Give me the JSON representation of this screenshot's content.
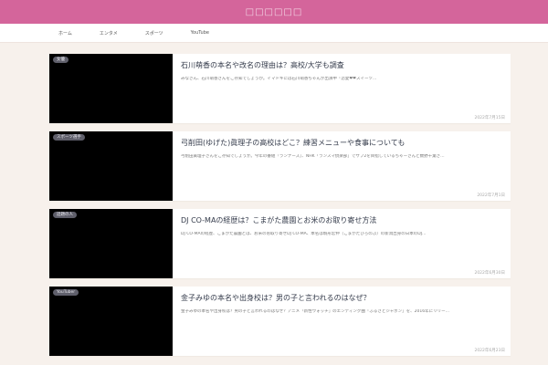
{
  "site": {
    "title": "□□□□□□"
  },
  "nav": [
    {
      "label": "ホーム"
    },
    {
      "label": "エンタメ"
    },
    {
      "label": "スポーツ"
    },
    {
      "label": "YouTube"
    }
  ],
  "posts": [
    {
      "category": "女優",
      "title": "石川萌香の本名や改名の理由は？高校/大学も調査",
      "excerpt": "みなさん、石川萌香さんをご存知でしょうか。イマドキには石川萌香ちゃんが出演中「恋愛❤❤スイーツ…",
      "date": "2022年7月15日"
    },
    {
      "category": "スポーツ選手",
      "title": "弓削田(ゆげた)眞理子の高校はどこ？練習メニューや食事についても",
      "excerpt": "弓削田眞理子さんをご存知でしょうか。今年の番組『ランナーズ』、NHK「ランスマ倶楽部」でサブ2を目指しているちゃーさんと数野千葉さ…",
      "date": "2022年7月1日"
    },
    {
      "category": "話題の人",
      "title": "DJ CO-MAの経歴は？こまがた農園とお米のお取り寄せ方法",
      "excerpt": "DJ CO-MAの経歴、こまがた農園とは、お米のお取り寄せDJ CO-MA、本名は駒形宏伸（こまがたひろのぶ）の新潟出身の日本のDJ…",
      "date": "2022年6月30日"
    },
    {
      "category": "YouTuber",
      "title": "金子みゆの本名や出身校は？男の子と言われるのはなぜ？",
      "excerpt": "金子みゆの本名や出身校は？男の子と言われるのはなぜ？アニメ「新性ウォッチ」のエンディング曲「ふるさとジャポン」を、2016年にリリー…",
      "date": "2022年6月23日"
    }
  ]
}
